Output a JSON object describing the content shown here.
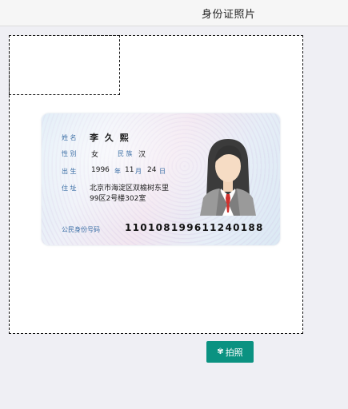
{
  "header": {
    "title": "身份证照片"
  },
  "id_card": {
    "name_label": "姓 名",
    "name_value": "李 久 熙",
    "sex_label": "性 别",
    "sex_value": "女",
    "ethnicity_label": "民 族",
    "ethnicity_value": "汉",
    "birth_label": "出 生",
    "birth_year": "1996",
    "year_unit": "年",
    "birth_month": "11",
    "month_unit": "月",
    "birth_day": "24",
    "day_unit": "日",
    "address_label": "住 址",
    "address_line1": "北京市海淀区双榆树东里",
    "address_line2": "99区2号楼302室",
    "id_number_label": "公民身份号码",
    "id_number_value": "110108199611240188"
  },
  "actions": {
    "capture_icon": "gear-icon",
    "capture_label": "拍照"
  },
  "colors": {
    "button_bg": "#0b9281",
    "label_blue": "#3a6ea5"
  }
}
